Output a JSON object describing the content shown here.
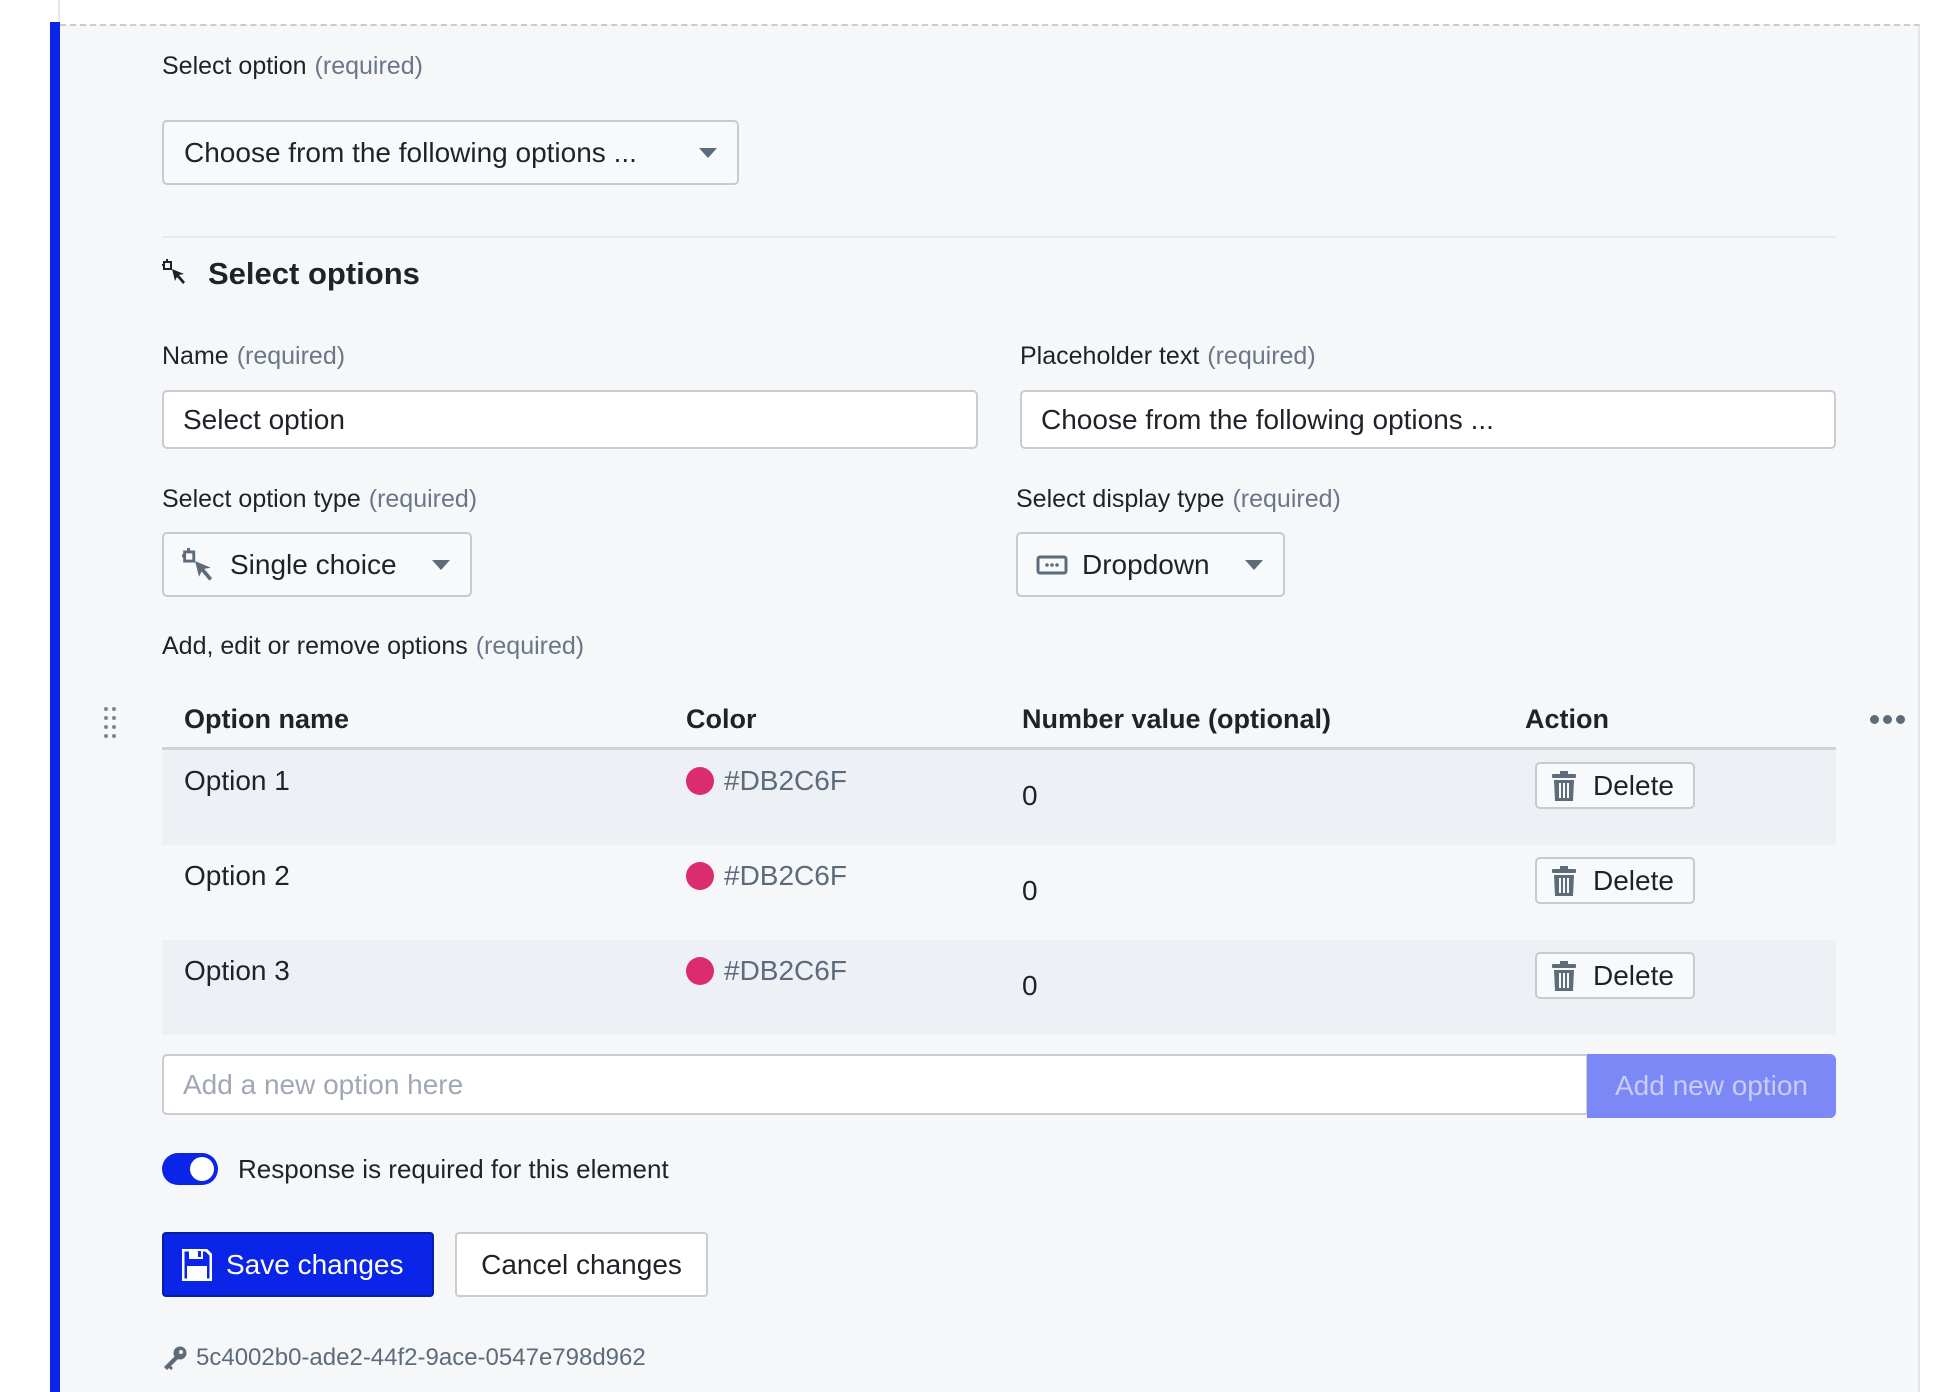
{
  "select_field": {
    "label": "Select option",
    "required_tag": "(required)",
    "placeholder": "Choose from the following options ..."
  },
  "section": {
    "icon": "cursor-select-icon",
    "title": "Select options"
  },
  "name_field": {
    "label": "Name",
    "required_tag": "(required)",
    "value": "Select option"
  },
  "placeholder_field": {
    "label": "Placeholder text",
    "required_tag": "(required)",
    "value": "Choose from the following options ..."
  },
  "option_type": {
    "label": "Select option type",
    "required_tag": "(required)",
    "icon": "cursor-select-icon",
    "value": "Single choice"
  },
  "display_type": {
    "label": "Select display type",
    "required_tag": "(required)",
    "icon": "dropdown-box-icon",
    "value": "Dropdown"
  },
  "options_editor": {
    "label": "Add, edit or remove options",
    "required_tag": "(required)",
    "columns": [
      "Option name",
      "Color",
      "Number value (optional)",
      "Action"
    ],
    "rows": [
      {
        "name": "Option 1",
        "color": "#DB2C6F",
        "number": "0",
        "action": "Delete"
      },
      {
        "name": "Option 2",
        "color": "#DB2C6F",
        "number": "0",
        "action": "Delete"
      },
      {
        "name": "Option 3",
        "color": "#DB2C6F",
        "number": "0",
        "action": "Delete"
      }
    ],
    "new_option_placeholder": "Add a new option here",
    "add_button": "Add new option"
  },
  "required_toggle": {
    "label": "Response is required for this element",
    "on": true
  },
  "actions": {
    "save": "Save changes",
    "cancel": "Cancel changes"
  },
  "element_id": "5c4002b0-ade2-44f2-9ace-0547e798d962",
  "colors": {
    "accent": "#0A24E8",
    "option_color": "#DB2C6F",
    "add_button_disabled": "#7B88F5"
  }
}
